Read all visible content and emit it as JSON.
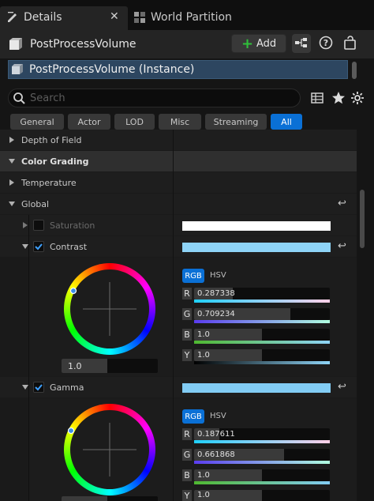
{
  "tabs": [
    {
      "label": "Details",
      "active": true
    },
    {
      "label": "World Partition",
      "active": false
    }
  ],
  "header": {
    "title": "PostProcessVolume",
    "add_label": "Add"
  },
  "instance_label": "PostProcessVolume (Instance)",
  "search": {
    "placeholder": "Search",
    "value": ""
  },
  "categories": [
    "General",
    "Actor",
    "LOD",
    "Misc",
    "Streaming",
    "All"
  ],
  "active_category": "All",
  "rows": {
    "depth_of_field": "Depth of Field",
    "color_grading": "Color Grading",
    "temperature": "Temperature",
    "global": "Global",
    "saturation": "Saturation",
    "contrast": "Contrast",
    "gamma": "Gamma"
  },
  "contrast": {
    "mode_rgb": "RGB",
    "mode_hsv": "HSV",
    "wheel_value": "1.0",
    "channels": [
      {
        "letter": "R",
        "value": "0.287338"
      },
      {
        "letter": "G",
        "value": "0.709234"
      },
      {
        "letter": "B",
        "value": "1.0"
      },
      {
        "letter": "Y",
        "value": "1.0"
      }
    ]
  },
  "gamma": {
    "mode_rgb": "RGB",
    "mode_hsv": "HSV",
    "channels": [
      {
        "letter": "R",
        "value": "0.187611"
      },
      {
        "letter": "G",
        "value": "0.661868"
      },
      {
        "letter": "B",
        "value": "1.0"
      },
      {
        "letter": "Y",
        "value": "1.0"
      }
    ]
  },
  "colors": {
    "accent_blue": "#0a70d6",
    "contrast_swatch": "#8ed4f7",
    "gamma_swatch": "#82ccf4",
    "saturation_swatch": "#ffffff"
  },
  "icons": [
    "details-icon",
    "close-icon",
    "world-partition-icon",
    "actor-icon",
    "plus-icon",
    "blueprint-icon",
    "help-icon",
    "lock-icon",
    "instance-icon",
    "search-icon",
    "table-icon",
    "star-icon",
    "settings-icon",
    "reset-icon"
  ]
}
